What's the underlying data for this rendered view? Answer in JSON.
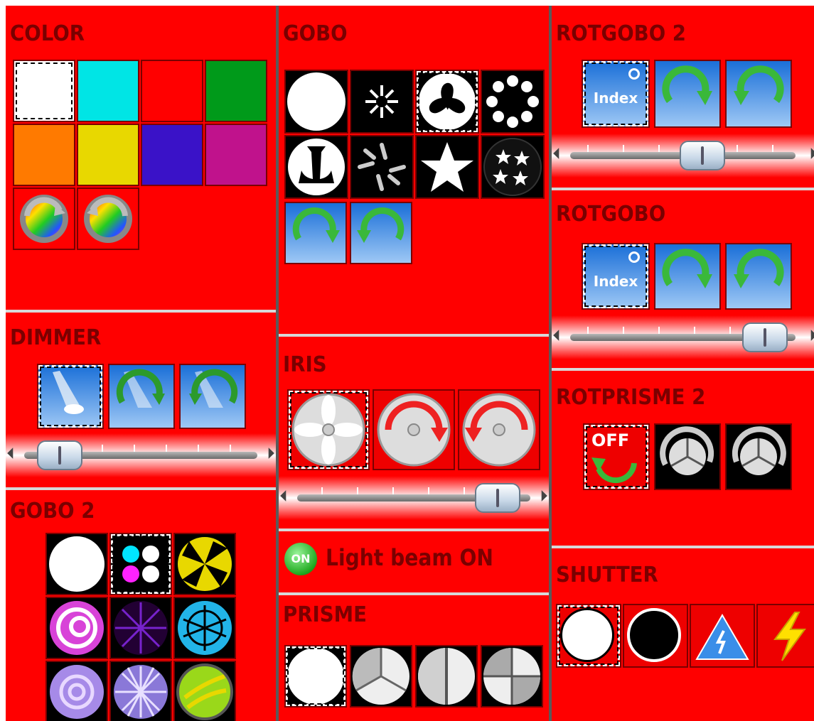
{
  "panels": {
    "color": {
      "title": "COLOR"
    },
    "gobo": {
      "title": "GOBO"
    },
    "rotgobo2": {
      "title": "ROTGOBO 2",
      "index_label": "Index",
      "slider_level": 0.56
    },
    "rotgobo": {
      "title": "ROTGOBO",
      "index_label": "Index",
      "slider_level": 0.96
    },
    "dimmer": {
      "title": "DIMMER",
      "slider_level": 0.06
    },
    "iris": {
      "title": "IRIS",
      "slider_level": 0.9
    },
    "rotprisme2": {
      "title": "ROTPRISME 2",
      "off_label": "OFF"
    },
    "lightbeam": {
      "on_label": "ON",
      "text": "Light beam ON"
    },
    "prisme": {
      "title": "PRISME"
    },
    "gobo2": {
      "title": "GOBO 2"
    },
    "shutter": {
      "title": "SHUTTER"
    }
  },
  "color_swatches": [
    "#ffffff",
    "#00e5e5",
    "#ff0000",
    "#009a1a",
    "#ff7a00",
    "#e8d800",
    "#3a12c8",
    "#c0128c"
  ],
  "icons": [
    "color-wheel-rotate-cw-icon",
    "color-wheel-rotate-ccw-icon",
    "rotate-cw-icon",
    "rotate-ccw-icon",
    "dimmer-beam-icon",
    "iris-icon",
    "prism-icon",
    "strobe-icon"
  ]
}
